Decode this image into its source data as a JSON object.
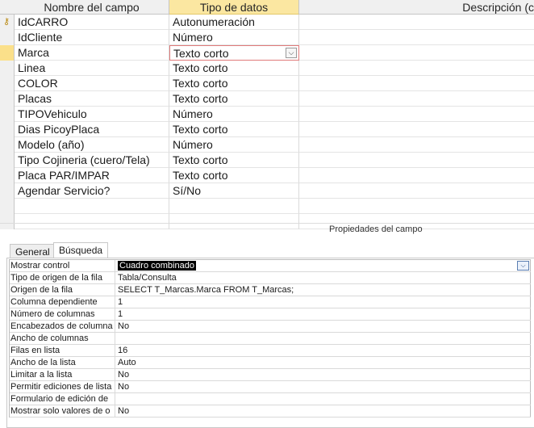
{
  "columns": {
    "field_name": "Nombre del campo",
    "data_type": "Tipo de datos",
    "description": "Descripción (c"
  },
  "fields": [
    {
      "name": "IdCARRO",
      "type": "Autonumeración"
    },
    {
      "name": "IdCliente",
      "type": "Número"
    },
    {
      "name": "Marca",
      "type": "Texto corto"
    },
    {
      "name": "Linea",
      "type": "Texto corto"
    },
    {
      "name": "COLOR",
      "type": "Texto corto"
    },
    {
      "name": "Placas",
      "type": "Texto corto"
    },
    {
      "name": "TIPOVehiculo",
      "type": "Número"
    },
    {
      "name": "Dias PicoyPlaca",
      "type": "Texto corto"
    },
    {
      "name": "Modelo (año)",
      "type": "Número"
    },
    {
      "name": "Tipo Cojineria (cuero/Tela)",
      "type": "Texto corto"
    },
    {
      "name": "Placa PAR/IMPAR",
      "type": "Texto corto"
    },
    {
      "name": "Agendar Servicio?",
      "type": "Sí/No"
    }
  ],
  "properties_title": "Propiedades del campo",
  "tabs": [
    "General",
    "Búsqueda"
  ],
  "properties": [
    {
      "label": "Mostrar control",
      "value": "Cuadro combinado"
    },
    {
      "label": "Tipo de origen de la fila",
      "value": "Tabla/Consulta"
    },
    {
      "label": "Origen de la fila",
      "value": "SELECT T_Marcas.Marca FROM T_Marcas;"
    },
    {
      "label": "Columna dependiente",
      "value": "1"
    },
    {
      "label": "Número de columnas",
      "value": "1"
    },
    {
      "label": "Encabezados de columna",
      "value": "No"
    },
    {
      "label": "Ancho de columnas",
      "value": ""
    },
    {
      "label": "Filas en lista",
      "value": "16"
    },
    {
      "label": "Ancho de la lista",
      "value": "Auto"
    },
    {
      "label": "Limitar a la lista",
      "value": "No"
    },
    {
      "label": "Permitir ediciones de lista",
      "value": "No"
    },
    {
      "label": "Formulario de edición de",
      "value": ""
    },
    {
      "label": "Mostrar solo valores de o",
      "value": "No"
    }
  ],
  "icons": {
    "primary_key": "key-icon",
    "dropdown": "chevron-down-icon"
  },
  "colors": {
    "header_selected": "#fbe7a1",
    "active_cell_border": "#e07a7a",
    "highlight": "#000000"
  }
}
